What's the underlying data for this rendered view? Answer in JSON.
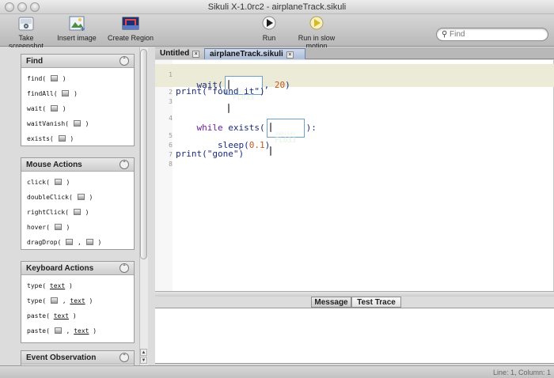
{
  "window": {
    "title": "Sikuli X-1.0rc2 - airplaneTrack.sikuli"
  },
  "toolbar": {
    "take_screenshot": "Take screenshot",
    "insert_image": "Insert image",
    "create_region": "Create Region",
    "run": "Run",
    "run_slow": "Run in slow motion",
    "search_placeholder": "Find"
  },
  "sidebar": {
    "find": {
      "title": "Find",
      "items": [
        "find(",
        "findAll(",
        "wait(",
        "waitVanish(",
        "exists("
      ]
    },
    "mouse": {
      "title": "Mouse Actions",
      "items": [
        "click(",
        "doubleClick(",
        "rightClick(",
        "hover(",
        "dragDrop("
      ]
    },
    "keyboard": {
      "title": "Keyboard Actions",
      "items": [
        "type(",
        "type(",
        "paste(",
        "paste("
      ],
      "text_arg": "text"
    },
    "event": {
      "title": "Event Observation"
    }
  },
  "tabs": {
    "untitled": "Untitled",
    "active": "airplaneTrack.sikuli"
  },
  "editor": {
    "line_numbers": [
      "1",
      "2",
      "3",
      "4",
      "5",
      "6",
      "7",
      "8"
    ],
    "line1_pre": "wait(",
    "line1_post": ", ",
    "line1_num": "20",
    "line1_close": ")",
    "line2": "print(\"found it\")",
    "line4_kw": "while",
    "line4_fn": " exists(",
    "line4_close": "):",
    "line5_pre": "    sleep(",
    "line5_num": "0.1",
    "line5_close": ")",
    "line7": "print(\"gone\")",
    "capture_top": "AWE1549",
    "capture_bottom": "FLO33"
  },
  "console": {
    "message_tab": "Message",
    "trace_tab": "Test Trace"
  },
  "status": {
    "position": "Line: 1, Column: 1"
  }
}
